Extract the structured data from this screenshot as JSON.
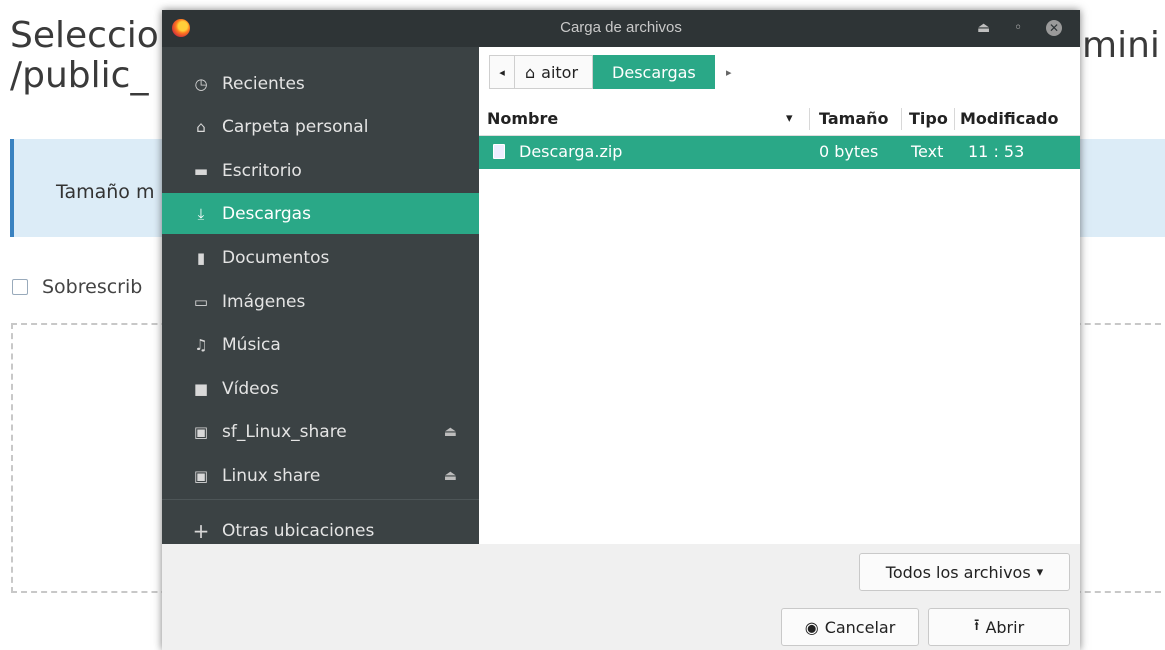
{
  "background_page": {
    "title_line1": "Seleccio",
    "title_line2": "/public_",
    "title_right": "mini",
    "info_text": "Tamaño m",
    "overwrite_label": "Sobrescrib"
  },
  "dialog": {
    "title": "Carga de archivos",
    "controls": {
      "eject": "⏏",
      "restore": "◦",
      "close": "✕"
    },
    "sidebar": {
      "items": [
        {
          "label": "Recientes",
          "icon": "clock-icon",
          "glyph": "◷"
        },
        {
          "label": "Carpeta personal",
          "icon": "home-icon",
          "glyph": "⌂"
        },
        {
          "label": "Escritorio",
          "icon": "desktop-icon",
          "glyph": "▬"
        },
        {
          "label": "Descargas",
          "icon": "download-icon",
          "glyph": "⤓"
        },
        {
          "label": "Documentos",
          "icon": "document-icon",
          "glyph": "▮"
        },
        {
          "label": "Imágenes",
          "icon": "image-icon",
          "glyph": "▭"
        },
        {
          "label": "Música",
          "icon": "music-icon",
          "glyph": "♫"
        },
        {
          "label": "Vídeos",
          "icon": "video-icon",
          "glyph": "■"
        },
        {
          "label": "sf_Linux_share",
          "icon": "drive-icon",
          "glyph": "▣"
        },
        {
          "label": "Linux share",
          "icon": "drive-icon",
          "glyph": "▣"
        },
        {
          "label": "Otras ubicaciones",
          "icon": "plus-icon",
          "glyph": "+"
        }
      ],
      "active_index": 3,
      "eject_glyph": "⏏"
    },
    "pathbar": {
      "back_glyph": "◂",
      "home_label": "aitor",
      "home_glyph": "⌂",
      "current": "Descargas",
      "forward_glyph": "▸"
    },
    "columns": {
      "name": "Nombre",
      "sort_glyph": "▾",
      "size": "Tamaño",
      "type": "Tipo",
      "modified": "Modificado"
    },
    "files": [
      {
        "name": "Descarga.zip",
        "size": "0 bytes",
        "type": "Text",
        "modified": "11 : 53"
      }
    ],
    "filter": {
      "label": "Todos los archivos",
      "glyph": "▾"
    },
    "buttons": {
      "cancel": "Cancelar",
      "cancel_glyph": "◉",
      "open": "Abrir",
      "open_glyph": "⭱"
    },
    "colors": {
      "accent": "#2aa887",
      "sidebar": "#3b4244",
      "titlebar": "#2e3436"
    }
  }
}
